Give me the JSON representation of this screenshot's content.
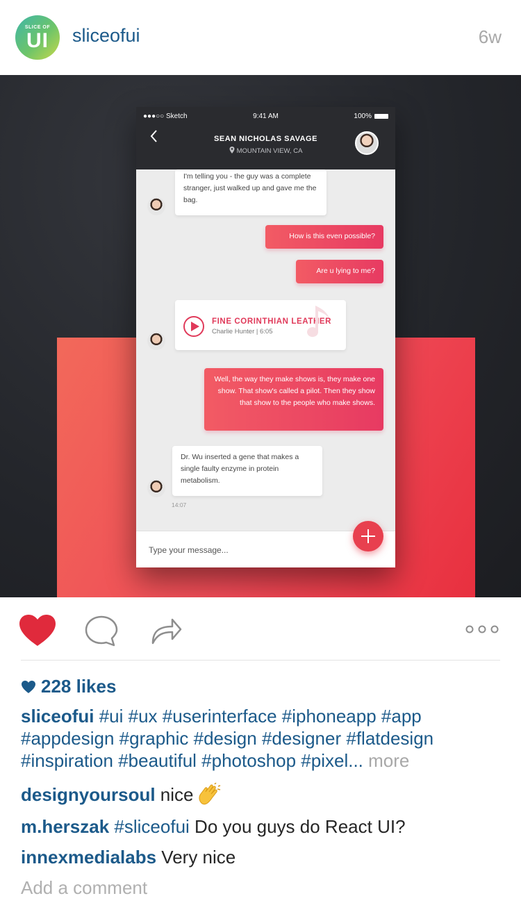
{
  "header": {
    "avatar_small": "SLICE OF",
    "avatar_big": "UI",
    "username": "sliceofui",
    "time_ago": "6w"
  },
  "phone": {
    "status_left": "●●●○○ Sketch",
    "status_time": "9:41 AM",
    "status_battery": "100%",
    "contact_name": "SEAN NICHOLAS SAVAGE",
    "contact_location": "MOUNTAIN VIEW, CA",
    "messages": {
      "m1": "I'm telling you - the guy was a complete stranger, just walked up and gave me the bag.",
      "m2": "How is this even possible?",
      "m3": "Are u lying to me?",
      "m5": "Well, the way they make shows is, they make one show. That show's called a pilot. Then they show that show to the people who make shows.",
      "m6": "Dr. Wu inserted a gene that makes a single faulty enzyme in protein metabolism."
    },
    "audio": {
      "title": "FINE CORINTHIAN LEATHER",
      "meta": "Charlie Hunter | 6:05"
    },
    "time_stamp": "14:07",
    "input_placeholder": "Type your message..."
  },
  "post": {
    "likes": "228 likes",
    "caption_user": "sliceofui",
    "caption_text": " #ui #ux #userinterface #iphoneapp #app #appdesign #graphic #design #designer #flatdesign #inspiration #beautiful #photoshop #pixel...",
    "caption_more": " more",
    "comments": [
      {
        "user": "designyoursoul",
        "text": " nice"
      },
      {
        "user": "m.herszak",
        "tag": " #sliceofui",
        "text": " Do you guys do React UI?"
      },
      {
        "user": "innexmedialabs",
        "text": " Very nice"
      }
    ],
    "add_comment": "Add a comment"
  },
  "colors": {
    "link_blue": "#1c5a8a",
    "heart_red": "#e02a3c",
    "accent_pink": "#e73a62"
  }
}
